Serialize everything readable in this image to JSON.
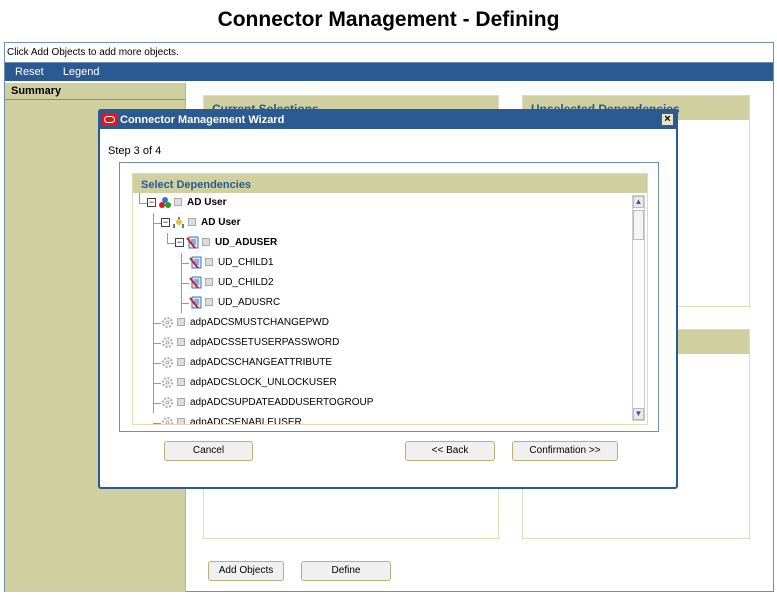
{
  "page": {
    "title": "Connector Management - Defining"
  },
  "info": {
    "text": "Click Add Objects to add more objects."
  },
  "menu": {
    "items": [
      "Reset",
      "Legend"
    ]
  },
  "sidebar": {
    "summary": "Summary"
  },
  "panels": {
    "current_selections": "Current Selections",
    "unselected_dependencies": "Unselected Dependencies"
  },
  "buttons": {
    "add_objects": "Add Objects",
    "define": "Define"
  },
  "wizard": {
    "title": "Connector Management Wizard",
    "close": "×",
    "step": "Step 3 of 4",
    "section_title": "Select Dependencies",
    "tree": [
      {
        "label": "AD User",
        "icon": "resource-object-icon",
        "bold": true,
        "level": 0,
        "expanded": true
      },
      {
        "label": "AD User",
        "icon": "process-definition-icon",
        "bold": true,
        "level": 1,
        "expanded": true
      },
      {
        "label": "UD_ADUSER",
        "icon": "form-icon",
        "bold": true,
        "level": 2,
        "expanded": true
      },
      {
        "label": "UD_CHILD1",
        "icon": "form-icon",
        "bold": false,
        "level": 3
      },
      {
        "label": "UD_CHILD2",
        "icon": "form-icon",
        "bold": false,
        "level": 3
      },
      {
        "label": "UD_ADUSRC",
        "icon": "form-icon",
        "bold": false,
        "level": 3
      },
      {
        "label": "adpADCSMUSTCHANGEPWD",
        "icon": "adapter-gear-icon",
        "bold": false,
        "level": 1
      },
      {
        "label": "adpADCSSETUSERPASSWORD",
        "icon": "adapter-gear-icon",
        "bold": false,
        "level": 1
      },
      {
        "label": "adpADCSCHANGEATTRIBUTE",
        "icon": "adapter-gear-icon",
        "bold": false,
        "level": 1
      },
      {
        "label": "adpADCSLOCK_UNLOCKUSER",
        "icon": "adapter-gear-icon",
        "bold": false,
        "level": 1
      },
      {
        "label": "adpADCSUPDATEADDUSERTOGROUP",
        "icon": "adapter-gear-icon",
        "bold": false,
        "level": 1
      },
      {
        "label": "adpADCSENABLEUSER",
        "icon": "adapter-gear-icon",
        "bold": false,
        "level": 1
      }
    ],
    "buttons": {
      "cancel": "Cancel",
      "back": "<< Back",
      "confirmation": "Confirmation >>"
    }
  }
}
